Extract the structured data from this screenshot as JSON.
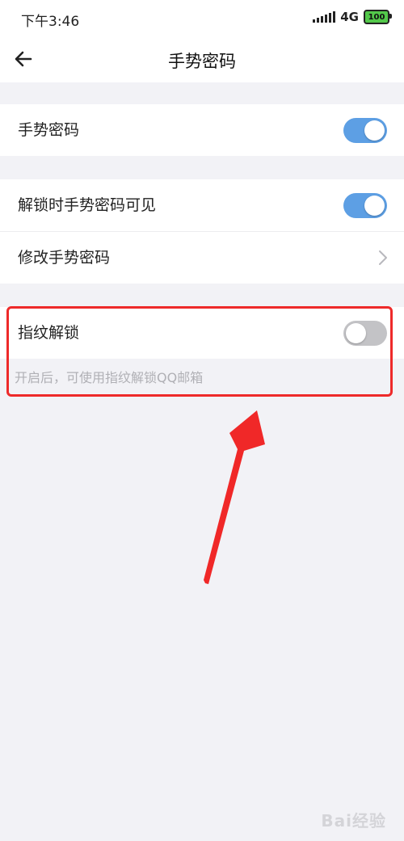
{
  "status_bar": {
    "time": "下午3:46",
    "network": "4G",
    "battery": "100"
  },
  "nav": {
    "title": "手势密码"
  },
  "settings": {
    "gesture_password": {
      "label": "手势密码",
      "enabled": true
    },
    "visible_when_unlocking": {
      "label": "解锁时手势密码可见",
      "enabled": true
    },
    "change_gesture_password": {
      "label": "修改手势密码"
    },
    "fingerprint_unlock": {
      "label": "指纹解锁",
      "enabled": false,
      "hint": "开启后，可使用指纹解锁QQ邮箱"
    }
  },
  "colors": {
    "toggle_on": "#5d9fe4",
    "toggle_off": "#c3c3c6",
    "annotation": "#ee2a2a"
  },
  "watermark": {
    "text": "Bai经验"
  }
}
